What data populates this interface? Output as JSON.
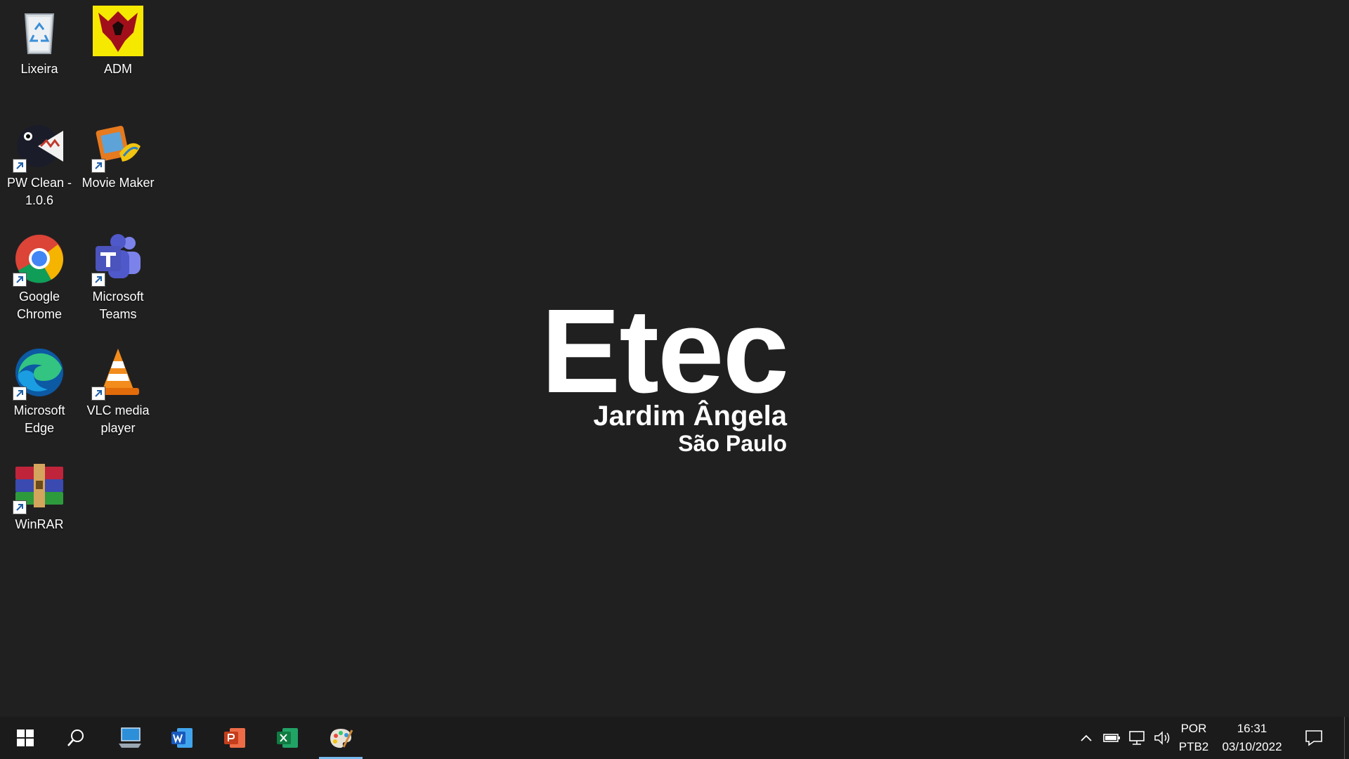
{
  "desktop_icons": [
    {
      "label": "Lixeira"
    },
    {
      "label": "ADM"
    },
    {
      "label": "PW Clean - 1.0.6"
    },
    {
      "label": "Movie Maker"
    },
    {
      "label": "Google Chrome"
    },
    {
      "label": "Microsoft Teams"
    },
    {
      "label": "Microsoft Edge"
    },
    {
      "label": "VLC media player"
    },
    {
      "label": "WinRAR"
    }
  ],
  "wallpaper": {
    "title": "Etec",
    "line1": "Jardim Ângela",
    "line2": "São Paulo"
  },
  "taskbar": {
    "pinned": [
      "start",
      "search",
      "this-pc",
      "word",
      "powerpoint",
      "excel",
      "paint"
    ],
    "active_app": "paint",
    "language": "POR",
    "keyboard": "PTB2",
    "time": "16:31",
    "date": "03/10/2022"
  },
  "colors": {
    "desktop_bg": "#212021",
    "taskbar_bg": "#1c1b1c",
    "active_indicator": "#76b9ed"
  }
}
